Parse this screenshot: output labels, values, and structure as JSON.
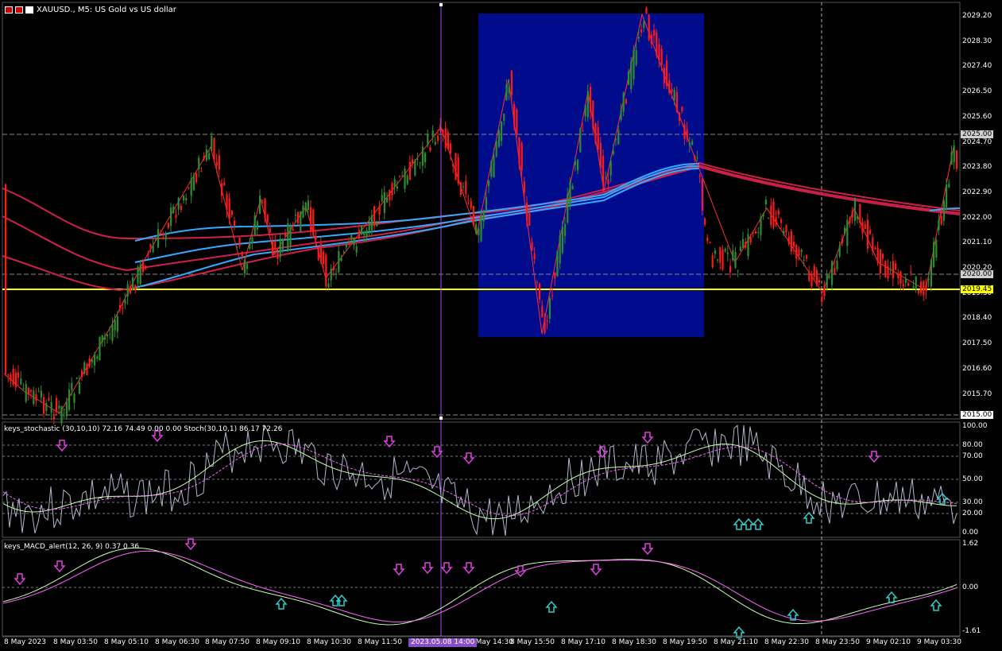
{
  "title": "XAUUSD., M5:  US Gold vs US dollar",
  "stoch_title": "keys_stochastic (30,10,10) 72.16 74.49 0.00 0.00  Stoch(30,10,1) 86.17 72.26",
  "macd_title": "keys_MACD_alert(12, 26, 9) 0.37 0.36",
  "price_labels": [
    "2029.20",
    "2028.30",
    "2027.40",
    "2026.50",
    "2025.60",
    "2024.70",
    "2023.80",
    "2022.90",
    "2022.00",
    "2021.10",
    "2020.20",
    "2019.30",
    "2018.40",
    "2017.50",
    "2016.60",
    "2015.70"
  ],
  "price_tags": {
    "p2025": "2025.00",
    "p2020": "2020.00",
    "current": "2019.45",
    "p2015": "2015.00"
  },
  "stoch_labels": [
    "100.00",
    "80.00",
    "70.00",
    "50.00",
    "30.00",
    "20.00",
    "0.00"
  ],
  "macd_labels": [
    "1.62",
    "0.00",
    "-1.61"
  ],
  "time_labels": [
    "8 May 2023",
    "8 May 03:50",
    "8 May 05:10",
    "8 May 06:30",
    "8 May 07:50",
    "8 May 09:10",
    "8 May 10:30",
    "8 May 11:50",
    "8 May 14:30",
    "8 May 15:50",
    "8 May 17:10",
    "8 May 18:30",
    "8 May 19:50",
    "8 May 21:10",
    "8 May 22:30",
    "8 May 23:50",
    "9 May 02:10",
    "9 May 03:30"
  ],
  "time_marker": "2023.05.08 14:00",
  "colors": {
    "bull": "#2e8b2e",
    "bear": "#ff1a1a",
    "ema_red": "#d0204a",
    "ema_blue": "#33aaff",
    "box": "#000c8c",
    "hline": "#ffff00",
    "cursor": "#a64dff"
  }
}
